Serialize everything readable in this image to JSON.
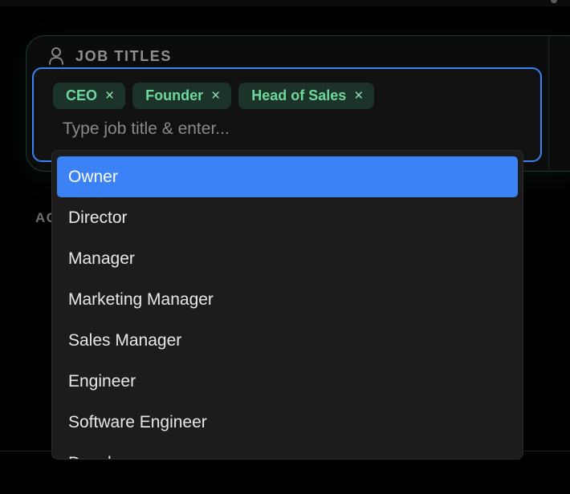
{
  "job_titles": {
    "label": "JOB TITLES",
    "tags": [
      {
        "label": "CEO",
        "remove": "×"
      },
      {
        "label": "Founder",
        "remove": "×"
      },
      {
        "label": "Head of Sales",
        "remove": "×"
      }
    ],
    "input": {
      "placeholder": "Type job title & enter...",
      "value": ""
    },
    "options": [
      {
        "label": "Owner",
        "highlighted": true
      },
      {
        "label": "Director",
        "highlighted": false
      },
      {
        "label": "Manager",
        "highlighted": false
      },
      {
        "label": "Marketing Manager",
        "highlighted": false
      },
      {
        "label": "Sales Manager",
        "highlighted": false
      },
      {
        "label": "Engineer",
        "highlighted": false
      },
      {
        "label": "Software Engineer",
        "highlighted": false
      },
      {
        "label": "Developer",
        "highlighted": false
      }
    ]
  },
  "obscured_section_label": "AC",
  "icons": {
    "section": "person-icon",
    "tag_remove": "close-icon"
  },
  "colors": {
    "accent": "#3b82f6",
    "tag_background": "#1c3329",
    "tag_text": "#6fd79e",
    "dropdown_background": "#1c1c1c",
    "page_background": "#000000"
  }
}
